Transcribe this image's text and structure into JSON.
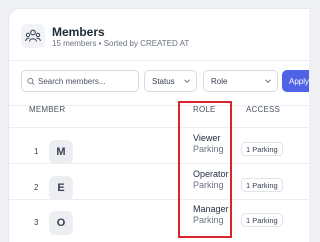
{
  "header": {
    "icon": "members-group-icon",
    "title": "Members",
    "subtitle": "15 members • Sorted by CREATED AT"
  },
  "filters": {
    "search_placeholder": "Search members...",
    "status_label": "Status",
    "role_label": "Role",
    "apply_label": "Apply"
  },
  "table": {
    "columns": [
      "MEMBER",
      "ROLE",
      "ACCESS"
    ],
    "rows": [
      {
        "index": "1",
        "initial": "M",
        "role": "Viewer",
        "role_scope": "Parking",
        "access": "1 Parking"
      },
      {
        "index": "2",
        "initial": "E",
        "role": "Operator",
        "role_scope": "Parking",
        "access": "1 Parking"
      },
      {
        "index": "3",
        "initial": "O",
        "role": "Manager",
        "role_scope": "Parking",
        "access": "1 Parking"
      }
    ]
  },
  "colors": {
    "accent": "#4f63e6",
    "highlight": "#d9242b"
  }
}
